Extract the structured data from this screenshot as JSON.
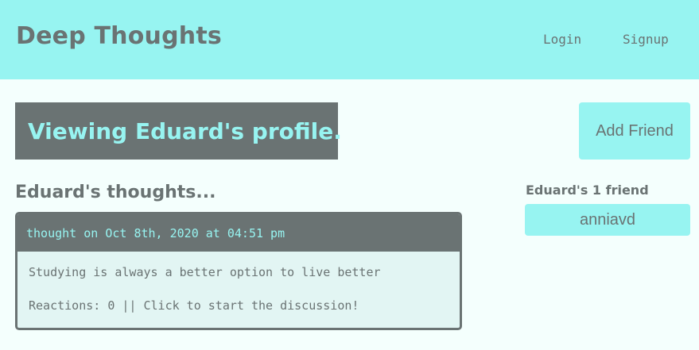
{
  "header": {
    "title": "Deep Thoughts",
    "nav": {
      "login": "Login",
      "signup": "Signup"
    }
  },
  "profile": {
    "banner": "Viewing Eduard's profile.",
    "add_friend_label": "Add Friend"
  },
  "thoughts": {
    "heading": "Eduard's thoughts...",
    "items": [
      {
        "meta": "thought on Oct 8th, 2020 at 04:51 pm",
        "text": "Studying is always a better option to live better",
        "reactions": "Reactions: 0 || Click to start the discussion!"
      }
    ]
  },
  "friends": {
    "heading": "Eduard's 1 friend",
    "list": [
      "anniavd"
    ]
  },
  "colors": {
    "accent": "#97f4f1",
    "dark": "#6a7373",
    "background": "#f4fffd",
    "card_body": "#e2f5f3"
  }
}
